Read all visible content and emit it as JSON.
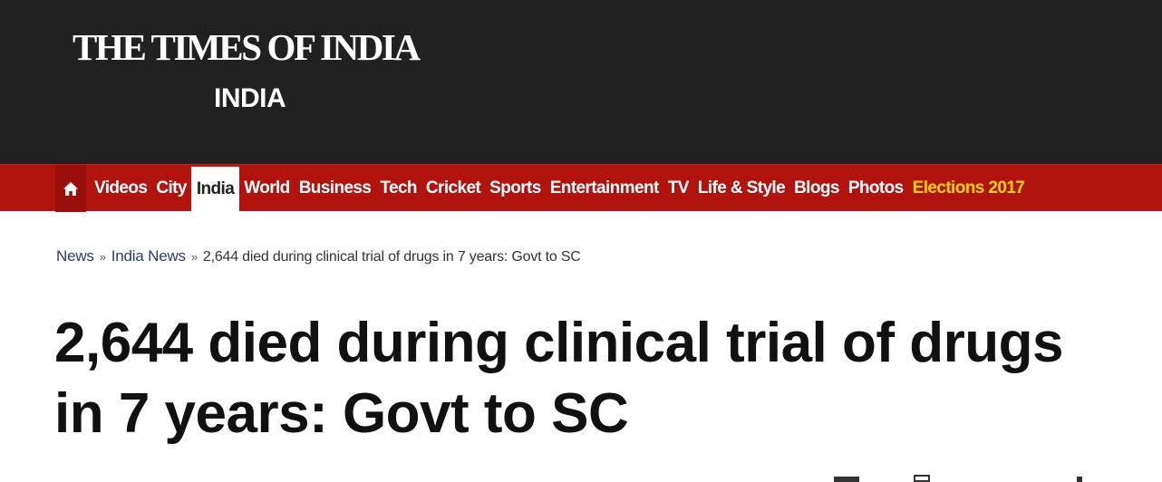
{
  "header": {
    "logo_text": "THE TIMES OF INDIA",
    "section_title": "INDIA",
    "background_color": "#212121"
  },
  "nav": {
    "background_color": "#b1130f",
    "home_icon": "home-icon",
    "items": [
      {
        "label": "Videos"
      },
      {
        "label": "City"
      },
      {
        "label": "India",
        "active": true
      },
      {
        "label": "World"
      },
      {
        "label": "Business"
      },
      {
        "label": "Tech"
      },
      {
        "label": "Cricket"
      },
      {
        "label": "Sports"
      },
      {
        "label": "Entertainment"
      },
      {
        "label": "TV"
      },
      {
        "label": "Life & Style"
      },
      {
        "label": "Blogs"
      },
      {
        "label": "Photos"
      },
      {
        "label": "Elections 2017",
        "highlight_color": "#ffd400"
      }
    ]
  },
  "breadcrumb": {
    "items": [
      "News",
      "India News"
    ],
    "separator": "»",
    "current": "2,644 died during clinical trial of drugs in 7 years: Govt to SC"
  },
  "article": {
    "headline": "2,644 died during clinical trial of drugs in 7 years: Govt to SC"
  }
}
